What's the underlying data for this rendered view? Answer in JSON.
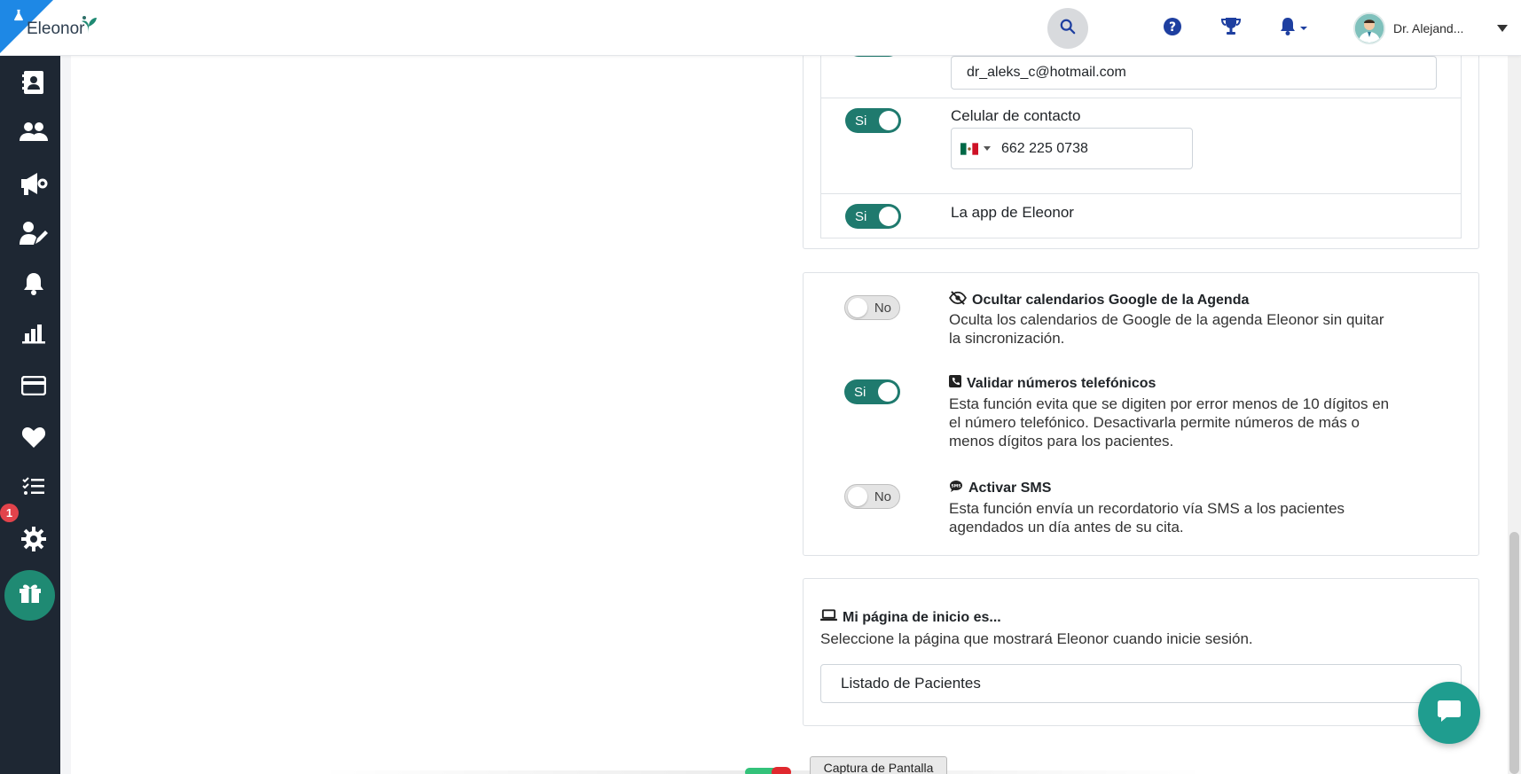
{
  "header": {
    "logo_text": "Eleonor",
    "user_name": "Dr. Alejand...",
    "icons": [
      "flask-icon",
      "search-icon",
      "help-icon",
      "trophy-icon",
      "bell-icon",
      "caret-down-icon"
    ]
  },
  "sidebar": {
    "items": [
      {
        "name": "contacts-icon"
      },
      {
        "name": "users-icon"
      },
      {
        "name": "megaphone-icon"
      },
      {
        "name": "user-edit-icon"
      },
      {
        "name": "bell-icon"
      },
      {
        "name": "bar-chart-icon"
      },
      {
        "name": "credit-card-icon"
      },
      {
        "name": "heart-icon"
      },
      {
        "name": "checklist-icon"
      },
      {
        "name": "gear-icon"
      }
    ],
    "badge_count": "1",
    "gift_icon": "gift-icon"
  },
  "contact_section": {
    "email_value": "dr_aleks_c@hotmail.com",
    "phone_label": "Celular de contacto",
    "phone_value": "662 225 0738",
    "phone_flag": "mexico-flag-icon",
    "app_label": "La app de Eleonor",
    "toggle_phone": "Si",
    "toggle_app": "Si"
  },
  "settings": {
    "hide_calendars": {
      "toggle": "No",
      "title": "Ocultar calendarios Google de la Agenda",
      "desc_line1": "Oculta los calendarios de Google de la agenda Eleonor sin quitar",
      "desc_line2": "la sincronización."
    },
    "validate_phones": {
      "toggle": "Si",
      "title": "Validar números telefónicos",
      "desc_line1": "Esta función evita que se digiten por error menos de 10 dígitos en",
      "desc_line2": "el número telefónico. Desactivarla permite números de más o",
      "desc_line3": "menos dígitos para los pacientes."
    },
    "sms": {
      "toggle": "No",
      "title": "Activar SMS",
      "desc_line1": "Esta función envía un recordatorio vía SMS a los pacientes",
      "desc_line2": "agendados un día antes de su cita."
    }
  },
  "home_page": {
    "title": "Mi página de inicio es...",
    "desc": "Seleccione la página que mostrará Eleonor cuando inicie sesión.",
    "selected": "Listado de Pacientes"
  },
  "floating": {
    "capture_label": "Captura de Pantalla"
  },
  "colors": {
    "accent": "#1f7a6e",
    "sidebar": "#1e2733",
    "primary_blue": "#1e3fa0"
  }
}
